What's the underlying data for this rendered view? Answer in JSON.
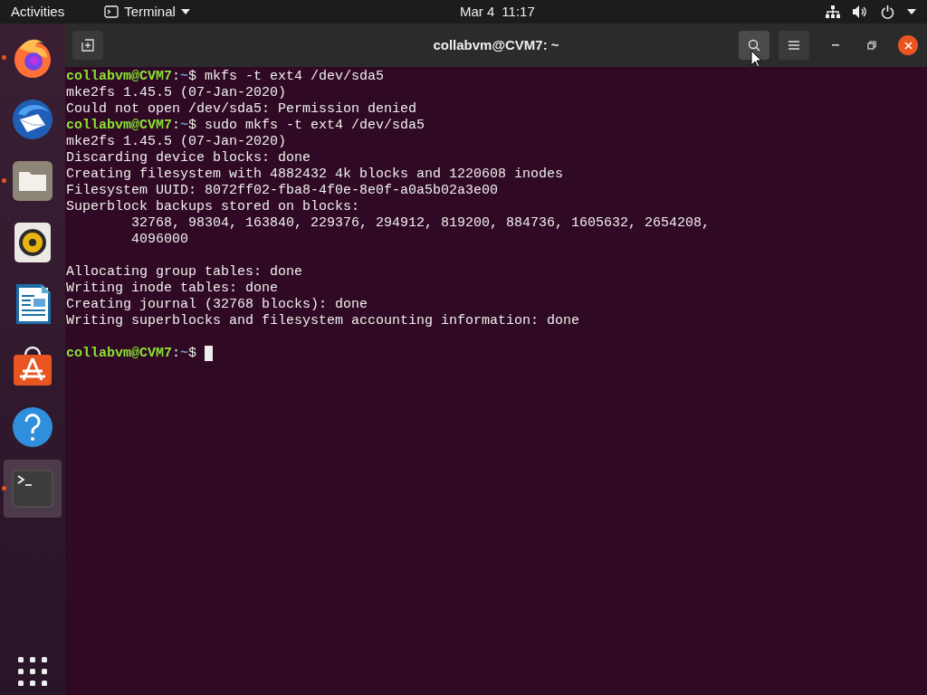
{
  "top_bar": {
    "activities": "Activities",
    "app_menu": "Terminal",
    "date": "Mar 4",
    "time": "11:17"
  },
  "dock": {
    "items": [
      {
        "kind": "browser",
        "running": true,
        "selected": false
      },
      {
        "kind": "mail",
        "running": false,
        "selected": false
      },
      {
        "kind": "files",
        "running": true,
        "selected": false
      },
      {
        "kind": "audio",
        "running": false,
        "selected": false
      },
      {
        "kind": "document",
        "running": false,
        "selected": false
      },
      {
        "kind": "store",
        "running": false,
        "selected": false
      },
      {
        "kind": "help",
        "running": false,
        "selected": false
      },
      {
        "kind": "terminal",
        "running": true,
        "selected": true
      }
    ]
  },
  "window": {
    "title": "collabvm@CVM7: ~",
    "header_buttons": [
      {
        "kind": "search",
        "hovered": true
      },
      {
        "kind": "menu",
        "hovered": false
      }
    ]
  },
  "terminal": {
    "lines": [
      {
        "kind": "prompt",
        "user": "collabvm@CVM7",
        "separator": ":",
        "path": "~",
        "symbol": "$",
        "command": "mkfs -t ext4 /dev/sda5"
      },
      {
        "kind": "output",
        "text": "mke2fs 1.45.5 (07-Jan-2020)"
      },
      {
        "kind": "output",
        "text": "Could not open /dev/sda5: Permission denied"
      },
      {
        "kind": "prompt",
        "user": "collabvm@CVM7",
        "separator": ":",
        "path": "~",
        "symbol": "$",
        "command": "sudo mkfs -t ext4 /dev/sda5"
      },
      {
        "kind": "output",
        "text": "mke2fs 1.45.5 (07-Jan-2020)"
      },
      {
        "kind": "output",
        "text": "Discarding device blocks: done"
      },
      {
        "kind": "output",
        "text": "Creating filesystem with 4882432 4k blocks and 1220608 inodes"
      },
      {
        "kind": "output",
        "text": "Filesystem UUID: 8072ff02-fba8-4f0e-8e0f-a0a5b02a3e00"
      },
      {
        "kind": "output",
        "text": "Superblock backups stored on blocks:"
      },
      {
        "kind": "output",
        "text": "        32768, 98304, 163840, 229376, 294912, 819200, 884736, 1605632, 2654208,"
      },
      {
        "kind": "output",
        "text": "        4096000"
      },
      {
        "kind": "blank"
      },
      {
        "kind": "output",
        "text": "Allocating group tables: done"
      },
      {
        "kind": "output",
        "text": "Writing inode tables: done"
      },
      {
        "kind": "output",
        "text": "Creating journal (32768 blocks): done"
      },
      {
        "kind": "output",
        "text": "Writing superblocks and filesystem accounting information: done"
      },
      {
        "kind": "blank"
      },
      {
        "kind": "prompt",
        "user": "collabvm@CVM7",
        "separator": ":",
        "path": "~",
        "symbol": "$",
        "cursor": true
      }
    ]
  }
}
